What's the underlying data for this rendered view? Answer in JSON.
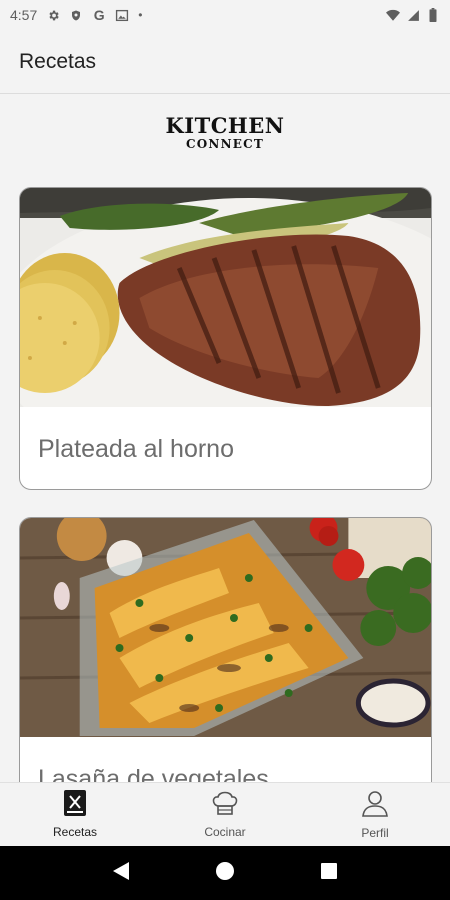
{
  "status_bar": {
    "time": "4:57",
    "left_icons": [
      "gear-icon",
      "shield-icon",
      "google-g-icon",
      "gallery-icon",
      "dot-icon"
    ],
    "google_letter": "G",
    "dot": "•",
    "right_icons": [
      "wifi-icon",
      "signal-icon",
      "battery-icon"
    ]
  },
  "app_bar": {
    "title": "Recetas"
  },
  "logo": {
    "line1": "KITCHEN",
    "line2": "CONNECT"
  },
  "recipes": [
    {
      "title": "Plateada al horno",
      "image": "grilled-steak-image"
    },
    {
      "title": "Lasaña de vegetales",
      "image": "vegetable-lasagna-image"
    }
  ],
  "bottom_nav": {
    "items": [
      {
        "label": "Recetas",
        "icon": "recipes-icon",
        "active": true
      },
      {
        "label": "Cocinar",
        "icon": "chef-hat-icon",
        "active": false
      },
      {
        "label": "Perfil",
        "icon": "profile-icon",
        "active": false
      }
    ]
  },
  "system_nav": [
    "back-icon",
    "home-icon",
    "recents-icon"
  ]
}
